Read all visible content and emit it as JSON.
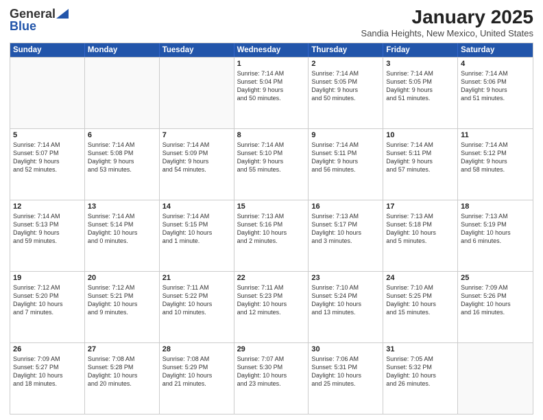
{
  "logo": {
    "general": "General",
    "blue": "Blue"
  },
  "title": "January 2025",
  "subtitle": "Sandia Heights, New Mexico, United States",
  "days": [
    "Sunday",
    "Monday",
    "Tuesday",
    "Wednesday",
    "Thursday",
    "Friday",
    "Saturday"
  ],
  "weeks": [
    [
      {
        "day": "",
        "info": ""
      },
      {
        "day": "",
        "info": ""
      },
      {
        "day": "",
        "info": ""
      },
      {
        "day": "1",
        "info": "Sunrise: 7:14 AM\nSunset: 5:04 PM\nDaylight: 9 hours\nand 50 minutes."
      },
      {
        "day": "2",
        "info": "Sunrise: 7:14 AM\nSunset: 5:05 PM\nDaylight: 9 hours\nand 50 minutes."
      },
      {
        "day": "3",
        "info": "Sunrise: 7:14 AM\nSunset: 5:05 PM\nDaylight: 9 hours\nand 51 minutes."
      },
      {
        "day": "4",
        "info": "Sunrise: 7:14 AM\nSunset: 5:06 PM\nDaylight: 9 hours\nand 51 minutes."
      }
    ],
    [
      {
        "day": "5",
        "info": "Sunrise: 7:14 AM\nSunset: 5:07 PM\nDaylight: 9 hours\nand 52 minutes."
      },
      {
        "day": "6",
        "info": "Sunrise: 7:14 AM\nSunset: 5:08 PM\nDaylight: 9 hours\nand 53 minutes."
      },
      {
        "day": "7",
        "info": "Sunrise: 7:14 AM\nSunset: 5:09 PM\nDaylight: 9 hours\nand 54 minutes."
      },
      {
        "day": "8",
        "info": "Sunrise: 7:14 AM\nSunset: 5:10 PM\nDaylight: 9 hours\nand 55 minutes."
      },
      {
        "day": "9",
        "info": "Sunrise: 7:14 AM\nSunset: 5:11 PM\nDaylight: 9 hours\nand 56 minutes."
      },
      {
        "day": "10",
        "info": "Sunrise: 7:14 AM\nSunset: 5:11 PM\nDaylight: 9 hours\nand 57 minutes."
      },
      {
        "day": "11",
        "info": "Sunrise: 7:14 AM\nSunset: 5:12 PM\nDaylight: 9 hours\nand 58 minutes."
      }
    ],
    [
      {
        "day": "12",
        "info": "Sunrise: 7:14 AM\nSunset: 5:13 PM\nDaylight: 9 hours\nand 59 minutes."
      },
      {
        "day": "13",
        "info": "Sunrise: 7:14 AM\nSunset: 5:14 PM\nDaylight: 10 hours\nand 0 minutes."
      },
      {
        "day": "14",
        "info": "Sunrise: 7:14 AM\nSunset: 5:15 PM\nDaylight: 10 hours\nand 1 minute."
      },
      {
        "day": "15",
        "info": "Sunrise: 7:13 AM\nSunset: 5:16 PM\nDaylight: 10 hours\nand 2 minutes."
      },
      {
        "day": "16",
        "info": "Sunrise: 7:13 AM\nSunset: 5:17 PM\nDaylight: 10 hours\nand 3 minutes."
      },
      {
        "day": "17",
        "info": "Sunrise: 7:13 AM\nSunset: 5:18 PM\nDaylight: 10 hours\nand 5 minutes."
      },
      {
        "day": "18",
        "info": "Sunrise: 7:13 AM\nSunset: 5:19 PM\nDaylight: 10 hours\nand 6 minutes."
      }
    ],
    [
      {
        "day": "19",
        "info": "Sunrise: 7:12 AM\nSunset: 5:20 PM\nDaylight: 10 hours\nand 7 minutes."
      },
      {
        "day": "20",
        "info": "Sunrise: 7:12 AM\nSunset: 5:21 PM\nDaylight: 10 hours\nand 9 minutes."
      },
      {
        "day": "21",
        "info": "Sunrise: 7:11 AM\nSunset: 5:22 PM\nDaylight: 10 hours\nand 10 minutes."
      },
      {
        "day": "22",
        "info": "Sunrise: 7:11 AM\nSunset: 5:23 PM\nDaylight: 10 hours\nand 12 minutes."
      },
      {
        "day": "23",
        "info": "Sunrise: 7:10 AM\nSunset: 5:24 PM\nDaylight: 10 hours\nand 13 minutes."
      },
      {
        "day": "24",
        "info": "Sunrise: 7:10 AM\nSunset: 5:25 PM\nDaylight: 10 hours\nand 15 minutes."
      },
      {
        "day": "25",
        "info": "Sunrise: 7:09 AM\nSunset: 5:26 PM\nDaylight: 10 hours\nand 16 minutes."
      }
    ],
    [
      {
        "day": "26",
        "info": "Sunrise: 7:09 AM\nSunset: 5:27 PM\nDaylight: 10 hours\nand 18 minutes."
      },
      {
        "day": "27",
        "info": "Sunrise: 7:08 AM\nSunset: 5:28 PM\nDaylight: 10 hours\nand 20 minutes."
      },
      {
        "day": "28",
        "info": "Sunrise: 7:08 AM\nSunset: 5:29 PM\nDaylight: 10 hours\nand 21 minutes."
      },
      {
        "day": "29",
        "info": "Sunrise: 7:07 AM\nSunset: 5:30 PM\nDaylight: 10 hours\nand 23 minutes."
      },
      {
        "day": "30",
        "info": "Sunrise: 7:06 AM\nSunset: 5:31 PM\nDaylight: 10 hours\nand 25 minutes."
      },
      {
        "day": "31",
        "info": "Sunrise: 7:05 AM\nSunset: 5:32 PM\nDaylight: 10 hours\nand 26 minutes."
      },
      {
        "day": "",
        "info": ""
      }
    ]
  ]
}
